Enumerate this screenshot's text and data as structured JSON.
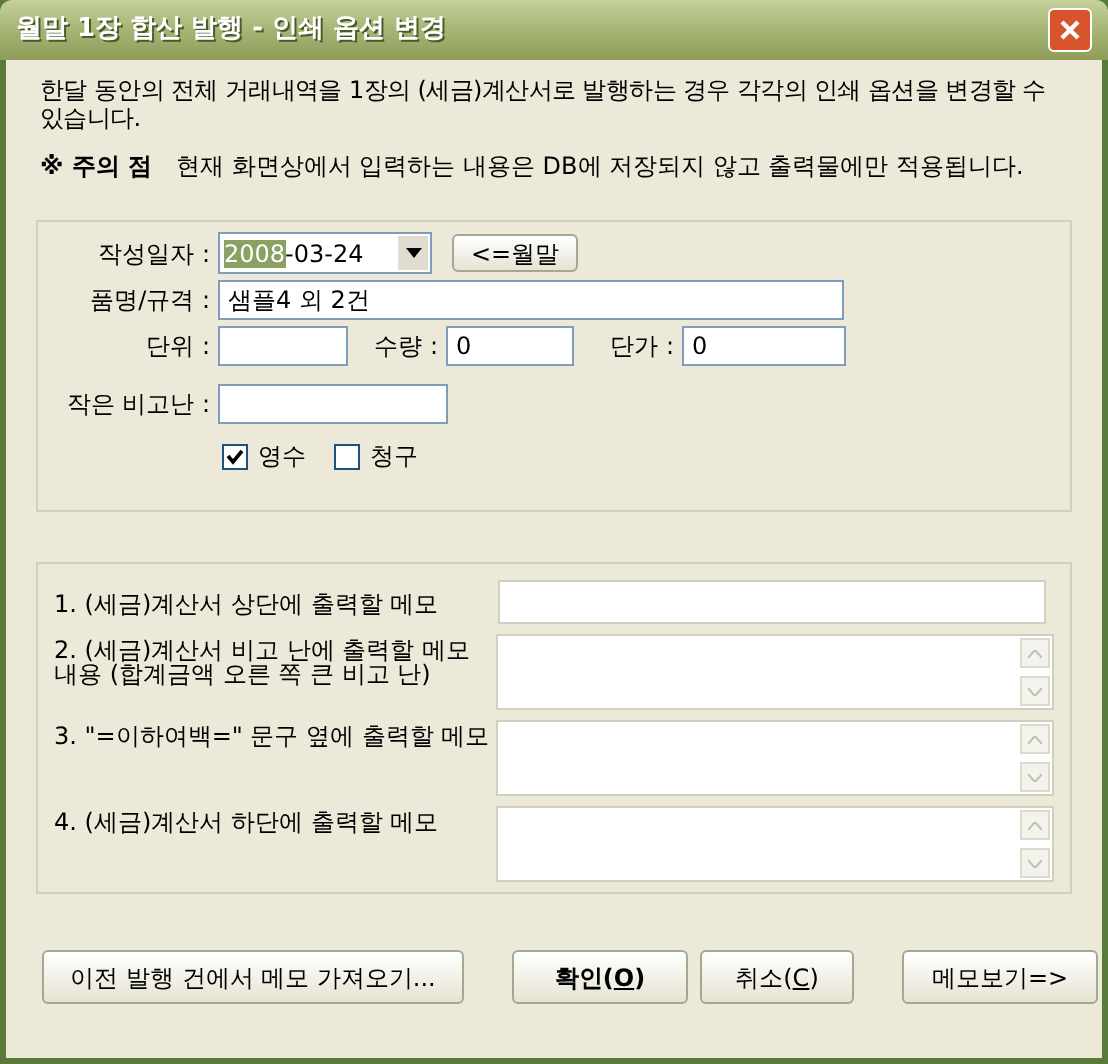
{
  "window": {
    "title": "월말 1장 합산 발행 - 인쇄 옵션 변경"
  },
  "intro": "한달 동안의 전체 거래내역을 1장의 (세금)계산서로 발행하는 경우 각각의 인쇄 옵션을 변경할 수 있습니다.",
  "notice": {
    "mark": "※ 주의 점",
    "text": "현재 화면상에서 입력하는 내용은 DB에 저장되지 않고 출력물에만 적용됩니다."
  },
  "form": {
    "date": {
      "label": "작성일자 :",
      "value_selected": "2008",
      "value_rest": "-03-24",
      "button": "<=월말"
    },
    "item": {
      "label": "품명/규격 :",
      "value": "샘플4 외 2건"
    },
    "unit": {
      "label": "단위 :"
    },
    "qty": {
      "label": "수량 :",
      "value": "0"
    },
    "price": {
      "label": "단가 :",
      "value": "0"
    },
    "note": {
      "label": "작은 비고난 :"
    },
    "checks": [
      {
        "label": "영수",
        "checked": true
      },
      {
        "label": "청구",
        "checked": false
      }
    ]
  },
  "memos": [
    {
      "label": "1. (세금)계산서 상단에 출력할 메모",
      "kind": "line"
    },
    {
      "label": "2. (세금)계산서 비고 난에 출력할 메모\n내용 (합계금액 오른 쪽 큰 비고 난)",
      "kind": "area"
    },
    {
      "label": "3. \"=이하여백=\" 문구 옆에 출력할 메모",
      "kind": "area"
    },
    {
      "label": "4. (세금)계산서 하단에 출력할 메모",
      "kind": "area"
    }
  ],
  "buttons": [
    {
      "before": "이전 발행 건에서 메모 가져오기...",
      "default": false
    },
    {
      "before": "확인(",
      "mnemonic": "O",
      "after": ")",
      "default": true
    },
    {
      "before": "취소(",
      "mnemonic": "C",
      "after": ")",
      "default": false
    },
    {
      "before": "메모보기=>",
      "default": false
    }
  ]
}
